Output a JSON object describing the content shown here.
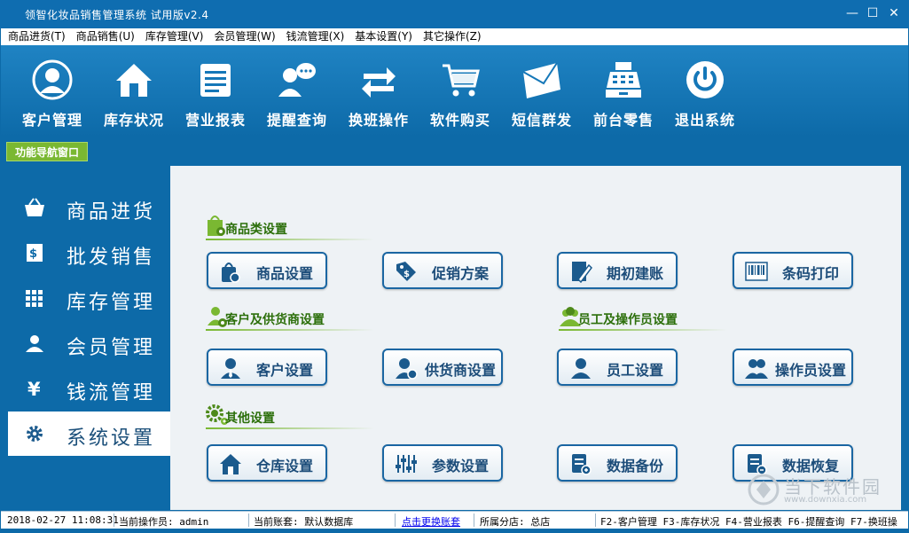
{
  "window": {
    "title": "领智化妆品销售管理系统 试用版v2.4",
    "minimize": "—",
    "maximize": "☐",
    "close": "✕"
  },
  "menu": [
    "商品进货(T)",
    "商品销售(U)",
    "库存管理(V)",
    "会员管理(W)",
    "钱流管理(X)",
    "基本设置(Y)",
    "其它操作(Z)"
  ],
  "toolbar": [
    "客户管理",
    "库存状况",
    "营业报表",
    "提醒查询",
    "换班操作",
    "软件购买",
    "短信群发",
    "前台零售",
    "退出系统"
  ],
  "nav_tab": "功能导航窗口",
  "sidebar": {
    "items": [
      "商品进货",
      "批发销售",
      "库存管理",
      "会员管理",
      "钱流管理",
      "系统设置"
    ],
    "active": "系统设置"
  },
  "sections": {
    "goods": {
      "title": "商品类设置",
      "buttons": [
        "商品设置",
        "促销方案",
        "期初建账",
        "条码打印"
      ]
    },
    "customer": {
      "title": "客户及供货商设置",
      "buttons": [
        "客户设置",
        "供货商设置"
      ]
    },
    "staff": {
      "title": "员工及操作员设置",
      "buttons": [
        "员工设置",
        "操作员设置"
      ]
    },
    "other": {
      "title": "其他设置",
      "buttons": [
        "仓库设置",
        "参数设置",
        "数据备份",
        "数据恢复"
      ]
    }
  },
  "statusbar": {
    "datetime": "2018-02-27 11:08:31",
    "operator": "当前操作员: admin",
    "account": "当前账套: 默认数据库",
    "switch_link": "点击更换账套",
    "branch": "所属分店: 总店",
    "shortcuts": "F2-客户管理 F3-库存状况 F4-营业报表 F6-提醒查询 F7-换班操"
  },
  "watermark": {
    "name": "当下软件园",
    "url": "www.downxia.com"
  },
  "colors": {
    "primary": "#0d6aa8",
    "accent_green": "#7ab832",
    "content_bg": "#eef2f5",
    "button_text": "#1d4d7a"
  }
}
